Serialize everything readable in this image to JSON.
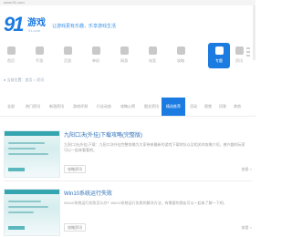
{
  "top_url": "www.91.com",
  "logo": {
    "number": "91",
    "text": "游戏",
    "sub": "91.com"
  },
  "slogan": "让游戏更有乐趣，乐享游戏生活",
  "nav": [
    {
      "label": "首页",
      "icon": "home-icon"
    },
    {
      "label": "手游",
      "icon": "phone-icon"
    },
    {
      "label": "页游",
      "icon": "globe-icon"
    },
    {
      "label": "单机",
      "icon": "monitor-icon"
    },
    {
      "label": "网游",
      "icon": "gamepad-icon"
    },
    {
      "label": "电竞",
      "icon": "trophy-icon"
    },
    {
      "label": "攻略",
      "icon": "book-icon"
    },
    {
      "label": "专题",
      "icon": "star-icon"
    },
    {
      "label": "资讯",
      "icon": "news-icon"
    }
  ],
  "tagline": "● 当前位置：首页 > 资讯",
  "tabs": [
    "全部",
    "热门资讯",
    "新游资讯",
    "游戏评测",
    "行业动态",
    "攻略心得",
    "图文资讯",
    "原创专栏",
    "精选推荐",
    "活动",
    "视频",
    "问答",
    "其他"
  ],
  "active_tab_index": 8,
  "articles": [
    {
      "title": "九阳口决(外挂)下载攻略(完整版)",
      "summary": "九阳口决(外挂)下载：九阳口决外挂完整攻略为大家带来最新的游戏下载地址以及相关的攻略介绍，感兴趣的玩家可以一起来看看吧。",
      "tag": "攻略资讯",
      "more": "查看 >"
    },
    {
      "title": "Win10系统运行失败",
      "summary": "Win10系统运行失败怎么办？Win10系统运行失败的解决方法，有需要的朋友可以一起来了解一下吧。",
      "tag": "攻略资讯",
      "more": "查看 >"
    }
  ]
}
